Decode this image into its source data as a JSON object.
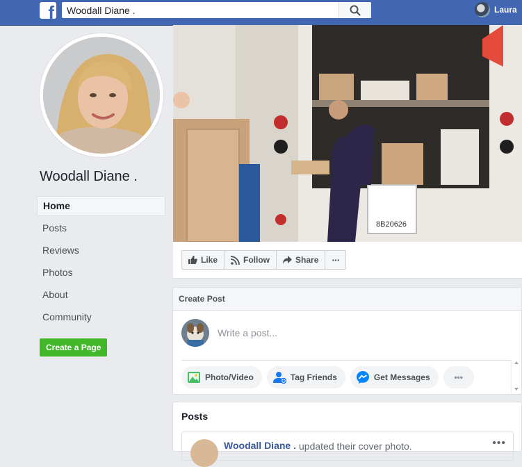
{
  "topbar": {
    "search_value": "Woodall Diane .",
    "user_name": "Laura"
  },
  "profile": {
    "name": "Woodall Diane ."
  },
  "nav": {
    "items": [
      {
        "label": "Home"
      },
      {
        "label": "Posts"
      },
      {
        "label": "Reviews"
      },
      {
        "label": "Photos"
      },
      {
        "label": "About"
      },
      {
        "label": "Community"
      }
    ],
    "create_page": "Create a Page"
  },
  "actions": {
    "like": "Like",
    "follow": "Follow",
    "share": "Share",
    "more": "···"
  },
  "cover": {
    "plate": "8B20626"
  },
  "create_post": {
    "title": "Create Post",
    "placeholder": "Write a post...",
    "buttons": {
      "photo_video": "Photo/Video",
      "tag_friends": "Tag Friends",
      "get_messages": "Get Messages",
      "more": "•••"
    }
  },
  "posts": {
    "title": "Posts",
    "first": {
      "author": "Woodall Diane .",
      "action": "updated their cover photo.",
      "more": "•••"
    }
  },
  "colors": {
    "topbar": "#4267b2",
    "create_page": "#42b72a",
    "link": "#385898"
  }
}
